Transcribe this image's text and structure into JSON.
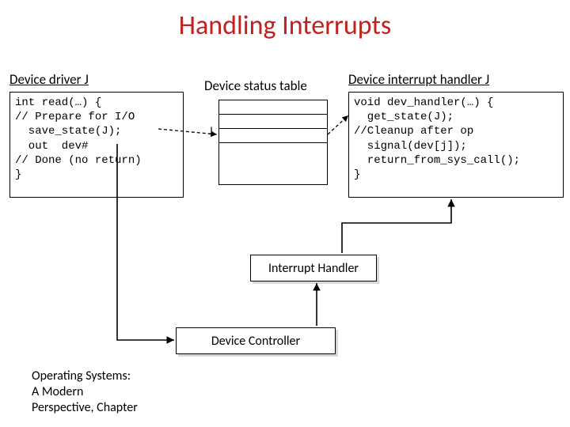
{
  "title": "Handling Interrupts",
  "labels": {
    "driver": "Device driver J",
    "status_table": "Device status table",
    "handler": "Device interrupt handler J",
    "j": "J",
    "interrupt_handler": "Interrupt Handler",
    "device_controller": "Device Controller"
  },
  "code": {
    "driver": "int read(…) {\n// Prepare for I/O\n  save_state(J);\n  out  dev#\n// Done (no return)\n}",
    "handler": "void dev_handler(…) {\n  get_state(J);\n//Cleanup after op\n  signal(dev[j]);\n  return_from_sys_call();\n}"
  },
  "footer": "Operating Systems:\nA Modern\nPerspective, Chapter"
}
